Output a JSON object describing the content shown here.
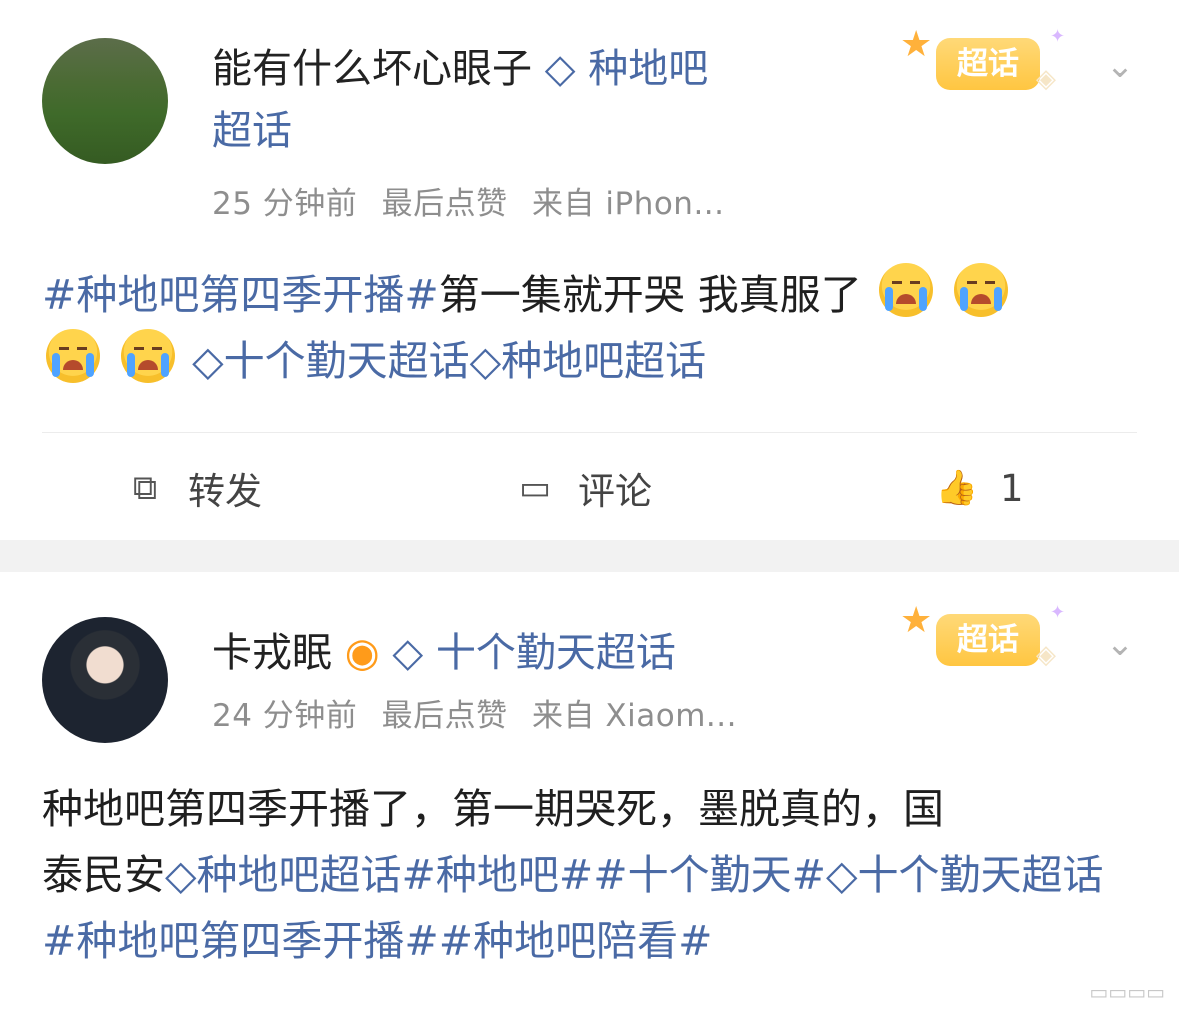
{
  "post1": {
    "username": "能有什么坏心眼子",
    "topic_line_1": "种地吧",
    "topic_line_2": "超话",
    "meta": {
      "time": "25 分钟前",
      "status": "最后点赞",
      "source": "来自 iPhon..."
    },
    "badge": "超话",
    "content": {
      "hashtag": "#种地吧第四季开播#",
      "text": "第一集就开哭 我真服了",
      "topic_a": "十个勤天超话",
      "topic_b": "种地吧超话"
    },
    "actions": {
      "forward": "转发",
      "comment": "评论",
      "like_count": "1"
    }
  },
  "post2": {
    "username": "卡戎眠",
    "topic": "十个勤天超话",
    "meta": {
      "time": "24 分钟前",
      "status": "最后点赞",
      "source": "来自 Xiaom..."
    },
    "badge": "超话",
    "content": {
      "line1": "种地吧第四季开播了，第一期哭死，墨脱真的，国",
      "line2_prefix": "泰民安",
      "topic_a": "种地吧超话",
      "tag1": "#种地吧#",
      "tag2": "#十个勤天#",
      "topic_b": "十个勤天超话",
      "tag3": "#种地吧第四季开播#",
      "tag4": "#种地吧陪看#"
    }
  },
  "icons": {
    "topic": "diamond-icon",
    "chevron": "chevron-down-icon",
    "forward": "forward-icon",
    "comment": "comment-icon",
    "like": "thumbs-up-icon",
    "emoji": "crying-face-icon"
  },
  "colors": {
    "link": "#4a6aa5",
    "badge": "#ffc641",
    "separator": "#f2f2f2"
  }
}
